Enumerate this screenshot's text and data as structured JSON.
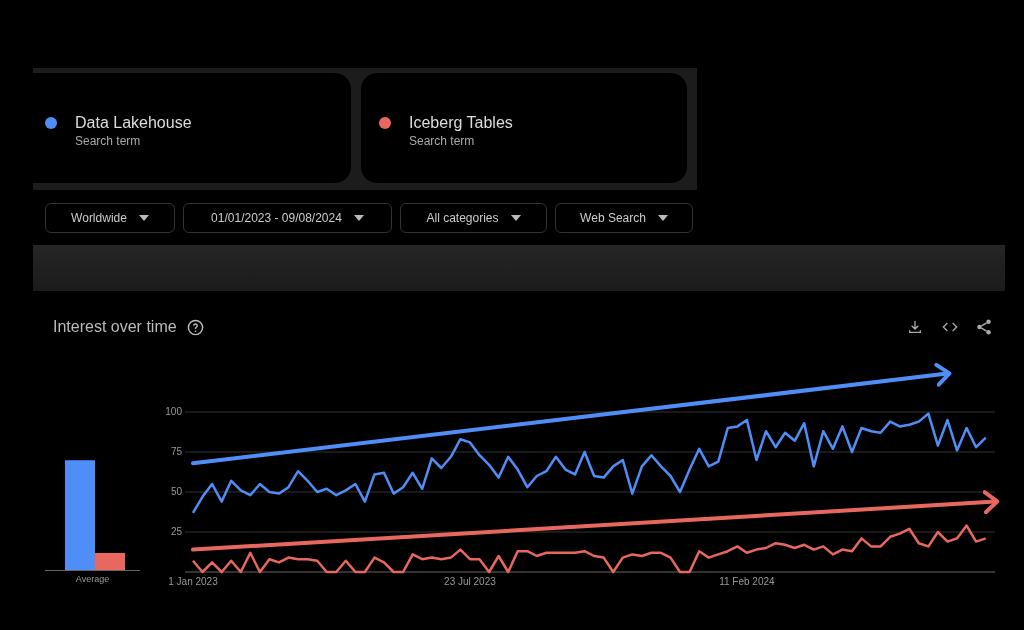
{
  "search_terms": [
    {
      "name": "Data Lakehouse",
      "sublabel": "Search term",
      "color": "#4f8ef7"
    },
    {
      "name": "Iceberg Tables",
      "sublabel": "Search term",
      "color": "#e8685f"
    }
  ],
  "filters": [
    {
      "label": "Worldwide"
    },
    {
      "label": "01/01/2023 - 09/08/2024"
    },
    {
      "label": "All categories"
    },
    {
      "label": "Web Search"
    }
  ],
  "interest_over_time": {
    "title": "Interest over time",
    "average_label": "Average",
    "chart_data": {
      "type": "line",
      "categories": [
        "1 Jan 2023",
        null,
        null,
        null,
        null,
        null,
        null,
        null,
        null,
        null,
        null,
        null,
        null,
        null,
        null,
        null,
        null,
        null,
        null,
        null,
        null,
        null,
        null,
        null,
        null,
        null,
        null,
        null,
        null,
        "23 Jul 2023",
        null,
        null,
        null,
        null,
        null,
        null,
        null,
        null,
        null,
        null,
        null,
        null,
        null,
        null,
        null,
        null,
        null,
        null,
        null,
        null,
        null,
        null,
        null,
        null,
        null,
        null,
        null,
        null,
        "11 Feb 2024",
        null,
        null,
        null,
        null,
        null,
        null,
        null,
        null,
        null,
        null,
        null,
        null,
        null,
        null,
        null,
        null,
        null,
        null,
        null,
        null,
        null,
        null,
        null,
        null,
        null
      ],
      "ylim": [
        0,
        100
      ],
      "grid": true,
      "yticks": [
        25,
        50,
        75,
        100
      ],
      "series": [
        {
          "color": "#4f8ef7",
          "values": [
            37,
            47,
            55,
            44,
            57,
            51,
            48,
            55,
            50,
            49,
            53,
            63,
            57,
            50,
            52,
            48,
            51,
            55,
            44,
            61,
            62,
            49,
            53,
            62,
            52,
            71,
            65,
            72,
            83,
            81,
            73,
            67,
            59,
            72,
            64,
            53,
            60,
            63,
            72,
            64,
            61,
            75,
            60,
            59,
            66,
            70,
            49,
            66,
            73,
            66,
            60,
            50,
            64,
            77,
            66,
            69,
            90,
            91,
            95,
            70,
            88,
            78,
            87,
            82,
            93,
            66,
            88,
            77,
            91,
            75,
            90,
            88,
            87,
            94,
            91,
            92,
            94,
            99,
            79,
            95,
            76,
            90,
            78,
            84
          ]
        },
        {
          "color": "#e8685f",
          "values": [
            7,
            0,
            6,
            0,
            7,
            0,
            12,
            0,
            8,
            6,
            9,
            8,
            8,
            7,
            0,
            0,
            7,
            0,
            0,
            9,
            6,
            0,
            0,
            11,
            8,
            9,
            8,
            9,
            14,
            8,
            8,
            0,
            10,
            0,
            13,
            13,
            10,
            12,
            12,
            12,
            12,
            13,
            10,
            9,
            0,
            9,
            11,
            10,
            12,
            12,
            9,
            0,
            0,
            13,
            9,
            11,
            13,
            16,
            12,
            14,
            15,
            18,
            17,
            15,
            17,
            14,
            16,
            11,
            14,
            13,
            21,
            16,
            16,
            22,
            24,
            27,
            18,
            16,
            25,
            19,
            21,
            29,
            19,
            21
          ]
        }
      ]
    }
  }
}
